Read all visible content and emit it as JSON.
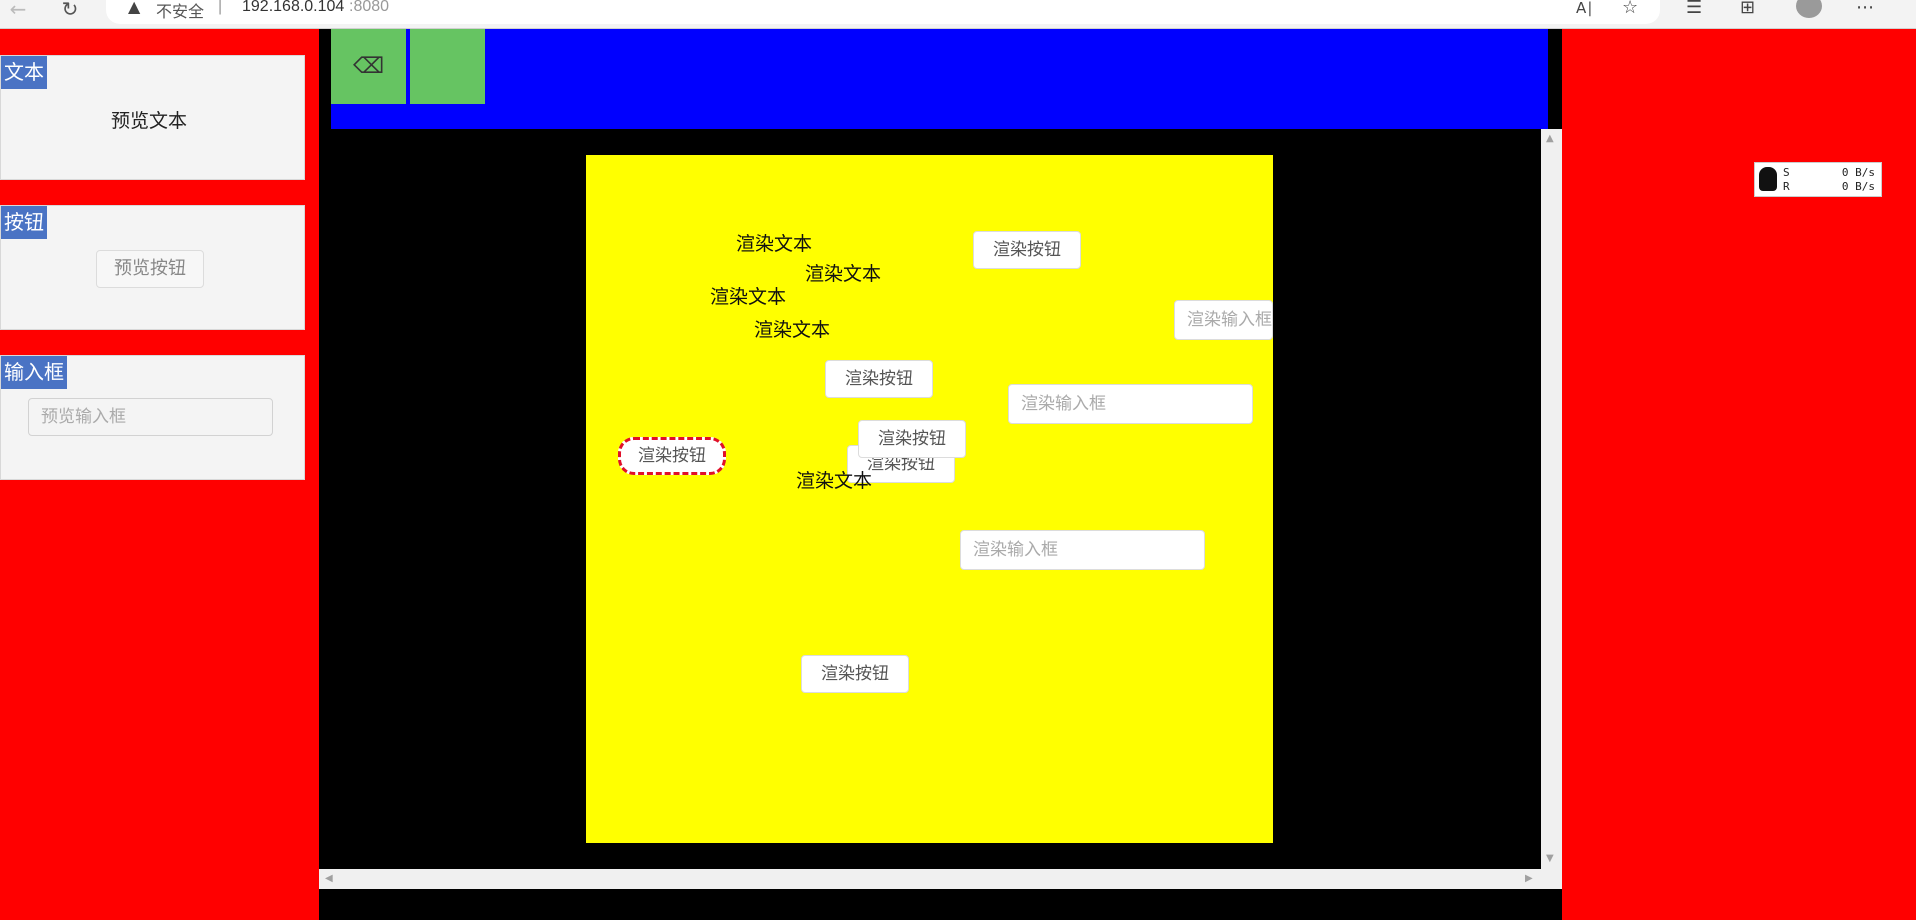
{
  "browser": {
    "security_label": "不安全",
    "separator": "|",
    "url_host": "192.168.0.104",
    "url_port": ":8080",
    "icons": [
      "back-arrow-icon",
      "reload-icon",
      "warning-icon",
      "read-aloud-icon",
      "favorites-add-icon",
      "favorites-icon",
      "collections-icon",
      "profile-icon",
      "more-icon"
    ]
  },
  "palette": {
    "text": {
      "tag": "文本",
      "preview": "预览文本"
    },
    "button": {
      "tag": "按钮",
      "preview": "预览按钮"
    },
    "input": {
      "tag": "输入框",
      "placeholder": "预览输入框"
    }
  },
  "toolbar": {
    "icons": [
      "backspace-icon"
    ]
  },
  "canvas": {
    "background": "#ffff00",
    "texts": [
      "渲染文本",
      "渲染文本",
      "渲染文本",
      "渲染文本",
      "渲染文本"
    ],
    "buttons": [
      "渲染按钮",
      "渲染按钮",
      "渲染按钮",
      "渲染按钮",
      "渲染按钮",
      "渲染按钮"
    ],
    "inputs": [
      "渲染输入框",
      "渲染输入框",
      "渲染输入框"
    ]
  },
  "net_widget": {
    "send_label": "S",
    "recv_label": "R",
    "send_value": "0 B/s",
    "recv_value": "0 B/s"
  },
  "colors": {
    "page_bg": "#ff0000",
    "toolbar_bg": "#0000ff",
    "tool_btn": "#66c462",
    "palette_tag": "#4a73c4",
    "selection": "#e0102a"
  }
}
